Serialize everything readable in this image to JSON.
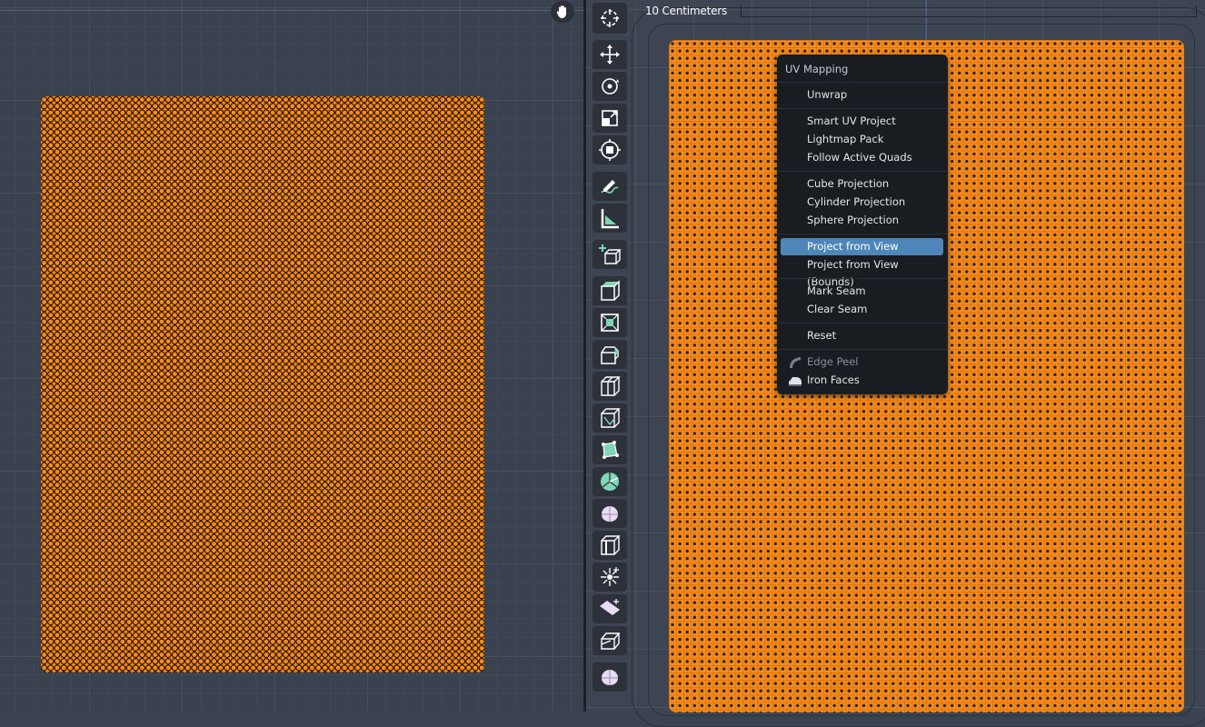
{
  "uv_editor": {
    "hand_icon": "hand-icon"
  },
  "viewport": {
    "scale_label": "10 Centimeters"
  },
  "toolbar": {
    "tools": [
      {
        "name": "cursor-tool",
        "icon": "cursor-icon"
      },
      {
        "name": "move-tool",
        "icon": "move-icon"
      },
      {
        "name": "rotate-tool",
        "icon": "rotate-icon"
      },
      {
        "name": "scale-tool",
        "icon": "scale-icon"
      },
      {
        "name": "transform-tool",
        "icon": "transform-icon"
      },
      {
        "name": "annotate-tool",
        "icon": "annotate-icon"
      },
      {
        "name": "measure-tool",
        "icon": "measure-icon"
      },
      {
        "name": "add-cube-tool",
        "icon": "add-cube-icon"
      },
      {
        "name": "extrude-tool",
        "icon": "extrude-icon"
      },
      {
        "name": "inset-tool",
        "icon": "inset-icon"
      },
      {
        "name": "bevel-tool",
        "icon": "bevel-icon"
      },
      {
        "name": "loop-cut-tool",
        "icon": "loop-cut-icon"
      },
      {
        "name": "knife-tool",
        "icon": "knife-icon"
      },
      {
        "name": "poly-build-tool",
        "icon": "poly-build-icon"
      },
      {
        "name": "spin-tool",
        "icon": "spin-icon"
      },
      {
        "name": "smooth-tool",
        "icon": "smooth-icon"
      },
      {
        "name": "edge-slide-tool",
        "icon": "edge-slide-icon"
      },
      {
        "name": "shrink-fatten-tool",
        "icon": "shrink-fatten-icon"
      },
      {
        "name": "shear-tool",
        "icon": "shear-icon"
      },
      {
        "name": "rip-tool",
        "icon": "rip-icon"
      },
      {
        "name": "sphere-tool",
        "icon": "sphere-icon"
      }
    ]
  },
  "menu": {
    "title": "UV Mapping",
    "items": [
      {
        "label": "Unwrap"
      },
      {
        "label": "Smart UV Project"
      },
      {
        "label": "Lightmap Pack"
      },
      {
        "label": "Follow Active Quads"
      },
      {
        "label": "Cube Projection"
      },
      {
        "label": "Cylinder Projection"
      },
      {
        "label": "Sphere Projection"
      },
      {
        "label": "Project from View",
        "active": true
      },
      {
        "label": "Project from View (Bounds)"
      },
      {
        "label": "Mark Seam"
      },
      {
        "label": "Clear Seam"
      },
      {
        "label": "Reset"
      },
      {
        "label": "Edge Peel",
        "disabled": true,
        "icon": "edge-peel-icon"
      },
      {
        "label": "Iron Faces",
        "icon": "iron-faces-icon"
      }
    ]
  },
  "colors": {
    "mesh": "#ff8c1a",
    "menu_bg": "#191c21",
    "active_item": "#4f86b9"
  }
}
